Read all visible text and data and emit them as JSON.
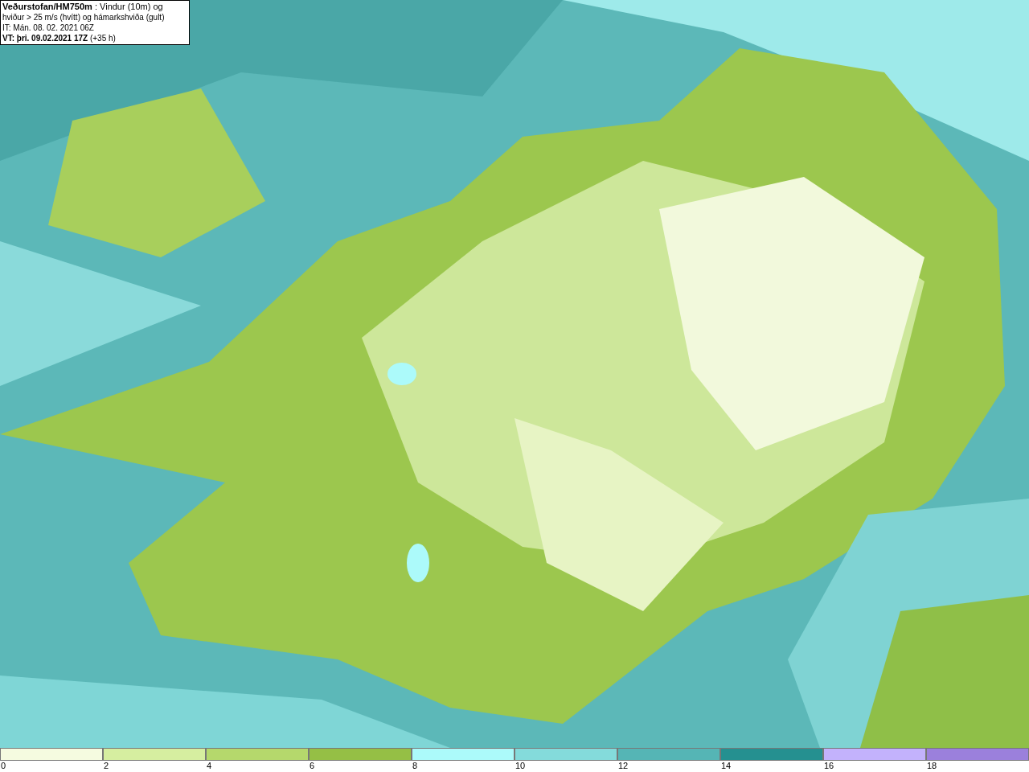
{
  "title_box": {
    "lines": [
      "**Veðurstofan/HM750m** : Vindur (10m) og",
      "hviður > 25 m/s (hvítt) og hámarkshviða (gult)",
      "IT: Mán. 08. 02. 2021 06Z",
      "**VT: þri. 09.02.2021 17Z** (+35 h)"
    ]
  },
  "legend": [
    {
      "label": "0",
      "color": "#f5fbe0"
    },
    {
      "label": "2",
      "color": "#d6eea0"
    },
    {
      "label": "4",
      "color": "#b5d86c"
    },
    {
      "label": "6",
      "color": "#95bf45"
    },
    {
      "label": "8",
      "color": "#acfafa"
    },
    {
      "label": "10",
      "color": "#84dbdb"
    },
    {
      "label": "12",
      "color": "#55b5b5"
    },
    {
      "label": "14",
      "color": "#259090"
    },
    {
      "label": "16",
      "color": "#c3b2fc"
    },
    {
      "label": "18",
      "color": "#9b80dc"
    }
  ]
}
